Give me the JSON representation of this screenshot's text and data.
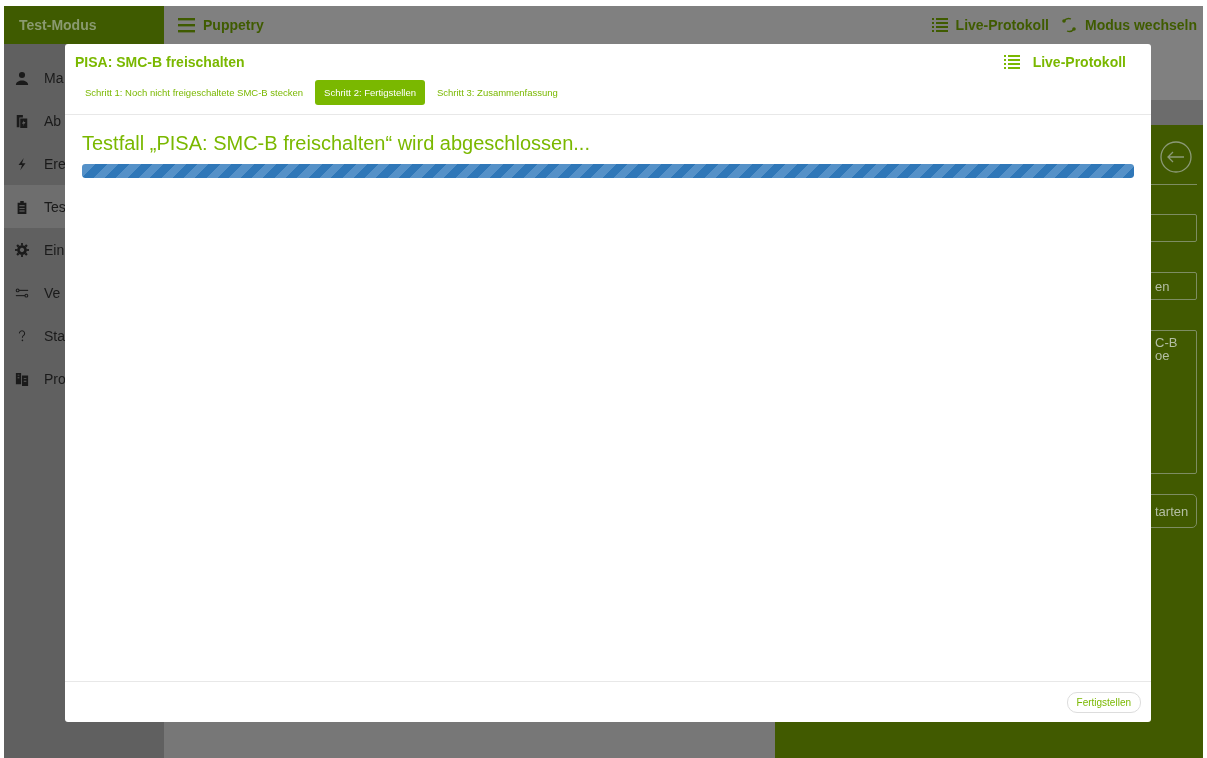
{
  "app": {
    "mode_label": "Test-Modus",
    "title": "Puppetry",
    "header_actions": [
      {
        "label": "Live-Protokoll"
      },
      {
        "label": "Modus wechseln"
      }
    ]
  },
  "sidebar": {
    "items": [
      {
        "label": "Ma",
        "selected": false
      },
      {
        "label": "Ab",
        "selected": false
      },
      {
        "label": "Ere",
        "selected": false
      },
      {
        "label": "Tes",
        "selected": true
      },
      {
        "label": "Ein",
        "selected": false
      },
      {
        "label": "Ve",
        "selected": false
      },
      {
        "label": "Sta",
        "selected": false
      },
      {
        "label": "Pro",
        "selected": false
      }
    ]
  },
  "side_panel": {
    "controls": [
      {
        "kind": "field"
      },
      {
        "kind": "field",
        "lines": [
          "en"
        ]
      },
      {
        "kind": "textarea",
        "lines": [
          "C-B",
          "oe"
        ]
      },
      {
        "kind": "button",
        "lines": [
          "tarten"
        ]
      }
    ]
  },
  "dialog": {
    "title": "PISA: SMC-B freischalten",
    "live_log": "Live-Protokoll",
    "steps": [
      {
        "label": "Schritt 1: Noch nicht freigeschaltete SMC-B stecken",
        "selected": false
      },
      {
        "label": "Schritt 2: Fertigstellen",
        "selected": true
      },
      {
        "label": "Schritt 3: Zusammenfassung",
        "selected": false
      }
    ],
    "heading": "Testfall „PISA: SMC-B freischalten“ wird abgeschlossen...",
    "progress": {
      "level": 1
    },
    "footer_button": "Fertigstellen"
  }
}
